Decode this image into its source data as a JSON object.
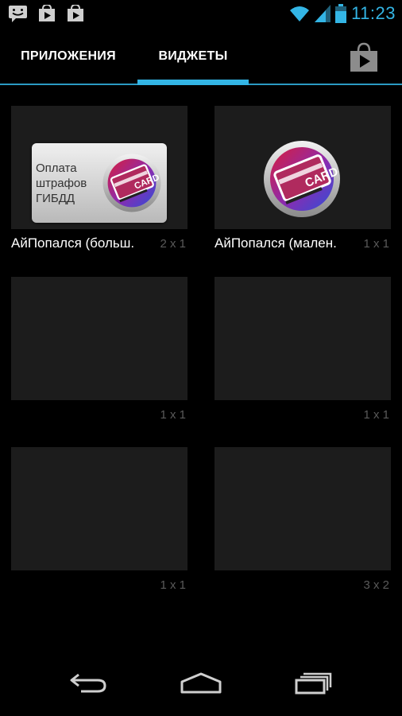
{
  "status_bar": {
    "time": "11:23",
    "notification_icons": [
      "messaging-icon",
      "play-store-icon",
      "play-store-icon"
    ],
    "system_icons": [
      "wifi-icon",
      "signal-icon",
      "battery-icon"
    ],
    "accent_color": "#33b5e5"
  },
  "tabs": {
    "apps_label": "ПРИЛОЖЕНИЯ",
    "widgets_label": "ВИДЖЕТЫ",
    "selected": "widgets",
    "store_icon": "play-store-bag-icon"
  },
  "widgets": [
    {
      "name": "АйПопался (больш.",
      "size": "2 x 1",
      "preview_text": [
        "Оплата",
        "штрафов",
        "ГИБДД"
      ],
      "emblem_text": "CARD"
    },
    {
      "name": "АйПопался (мален.",
      "size": "1 x 1",
      "emblem_text": "CARD"
    },
    {
      "name": "",
      "size": "1 x 1"
    },
    {
      "name": "",
      "size": "1 x 1"
    },
    {
      "name": "",
      "size": "1 x 1"
    },
    {
      "name": "",
      "size": "3 x 2"
    }
  ],
  "navbar": {
    "buttons": [
      "back-icon",
      "home-icon",
      "recent-apps-icon"
    ]
  }
}
